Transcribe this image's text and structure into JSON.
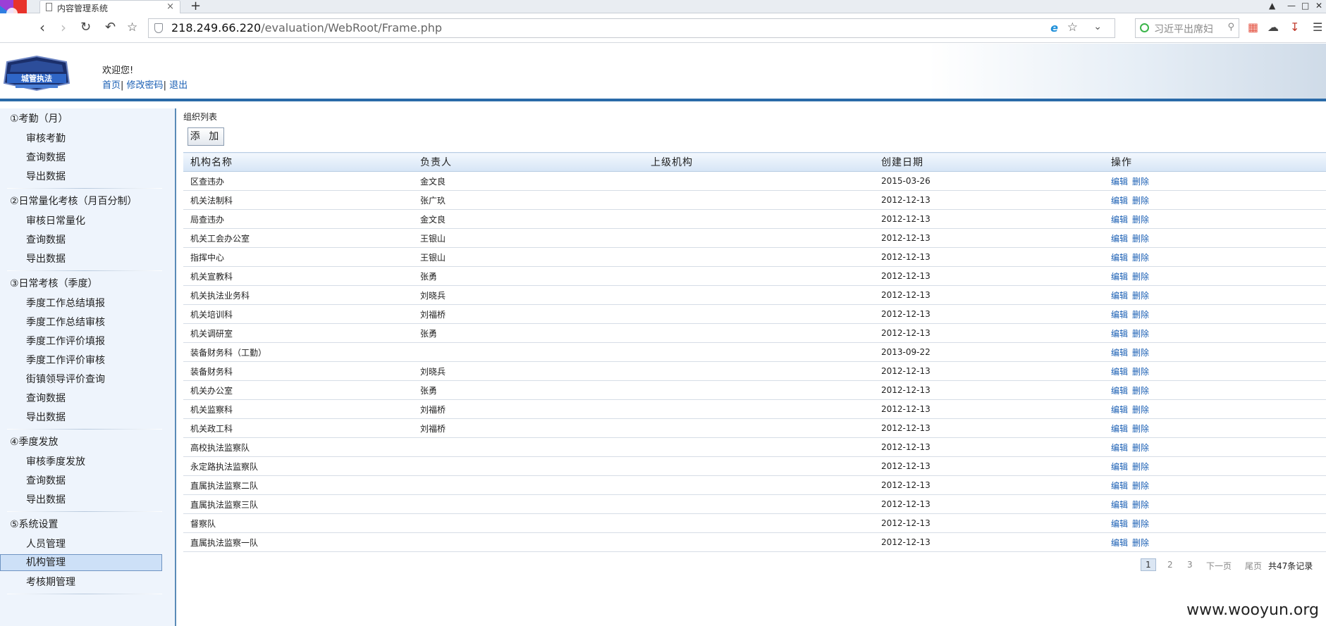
{
  "browser": {
    "tab_title": "内容管理系统",
    "tab_close": "×",
    "new_tab": "+",
    "url_host": "218.249.66.220",
    "url_path": "/evaluation/WebRoot/Frame.php",
    "search_placeholder": "习近平出席妇"
  },
  "header": {
    "welcome": "欢迎您!",
    "links": [
      "首页",
      "修改密码",
      "退出"
    ],
    "separator": "|",
    "logo_text": "城管执法"
  },
  "sidebar": {
    "groups": [
      {
        "title": "①考勤（月）",
        "items": [
          "审核考勤",
          "查询数据",
          "导出数据"
        ]
      },
      {
        "title": "②日常量化考核（月百分制）",
        "items": [
          "审核日常量化",
          "查询数据",
          "导出数据"
        ]
      },
      {
        "title": "③日常考核（季度）",
        "items": [
          "季度工作总结填报",
          "季度工作总结审核",
          "季度工作评价填报",
          "季度工作评价审核",
          "街镇领导评价查询",
          "查询数据",
          "导出数据"
        ]
      },
      {
        "title": "④季度发放",
        "items": [
          "审核季度发放",
          "查询数据",
          "导出数据"
        ]
      },
      {
        "title": "⑤系统设置",
        "items": [
          "人员管理",
          "机构管理",
          "考核期管理"
        ]
      }
    ],
    "active_item": "机构管理"
  },
  "main": {
    "page_title": "组织列表",
    "add_button": "添 加",
    "columns": [
      "机构名称",
      "负责人",
      "上级机构",
      "创建日期",
      "操作"
    ],
    "op_edit": "编辑",
    "op_delete": "删除",
    "rows": [
      [
        "区查违办",
        "金文良",
        "",
        "2015-03-26"
      ],
      [
        "机关法制科",
        "张广玖",
        "",
        "2012-12-13"
      ],
      [
        "局查违办",
        "金文良",
        "",
        "2012-12-13"
      ],
      [
        "机关工会办公室",
        "王银山",
        "",
        "2012-12-13"
      ],
      [
        "指挥中心",
        "王银山",
        "",
        "2012-12-13"
      ],
      [
        "机关宣教科",
        "张勇",
        "",
        "2012-12-13"
      ],
      [
        "机关执法业务科",
        "刘晓兵",
        "",
        "2012-12-13"
      ],
      [
        "机关培训科",
        "刘福桥",
        "",
        "2012-12-13"
      ],
      [
        "机关调研室",
        "张勇",
        "",
        "2012-12-13"
      ],
      [
        "装备财务科（工勤）",
        "",
        "",
        "2013-09-22"
      ],
      [
        "装备财务科",
        "刘晓兵",
        "",
        "2012-12-13"
      ],
      [
        "机关办公室",
        "张勇",
        "",
        "2012-12-13"
      ],
      [
        "机关监察科",
        "刘福桥",
        "",
        "2012-12-13"
      ],
      [
        "机关政工科",
        "刘福桥",
        "",
        "2012-12-13"
      ],
      [
        "高校执法监察队",
        "",
        "",
        "2012-12-13"
      ],
      [
        "永定路执法监察队",
        "",
        "",
        "2012-12-13"
      ],
      [
        "直属执法监察二队",
        "",
        "",
        "2012-12-13"
      ],
      [
        "直属执法监察三队",
        "",
        "",
        "2012-12-13"
      ],
      [
        "督察队",
        "",
        "",
        "2012-12-13"
      ],
      [
        "直属执法监察一队",
        "",
        "",
        "2012-12-13"
      ]
    ],
    "pager": {
      "current": "1",
      "pages": [
        "2",
        "3"
      ],
      "next": "下一页",
      "last": "尾页",
      "total": "共47条记录"
    }
  },
  "watermark": "www.wooyun.org"
}
